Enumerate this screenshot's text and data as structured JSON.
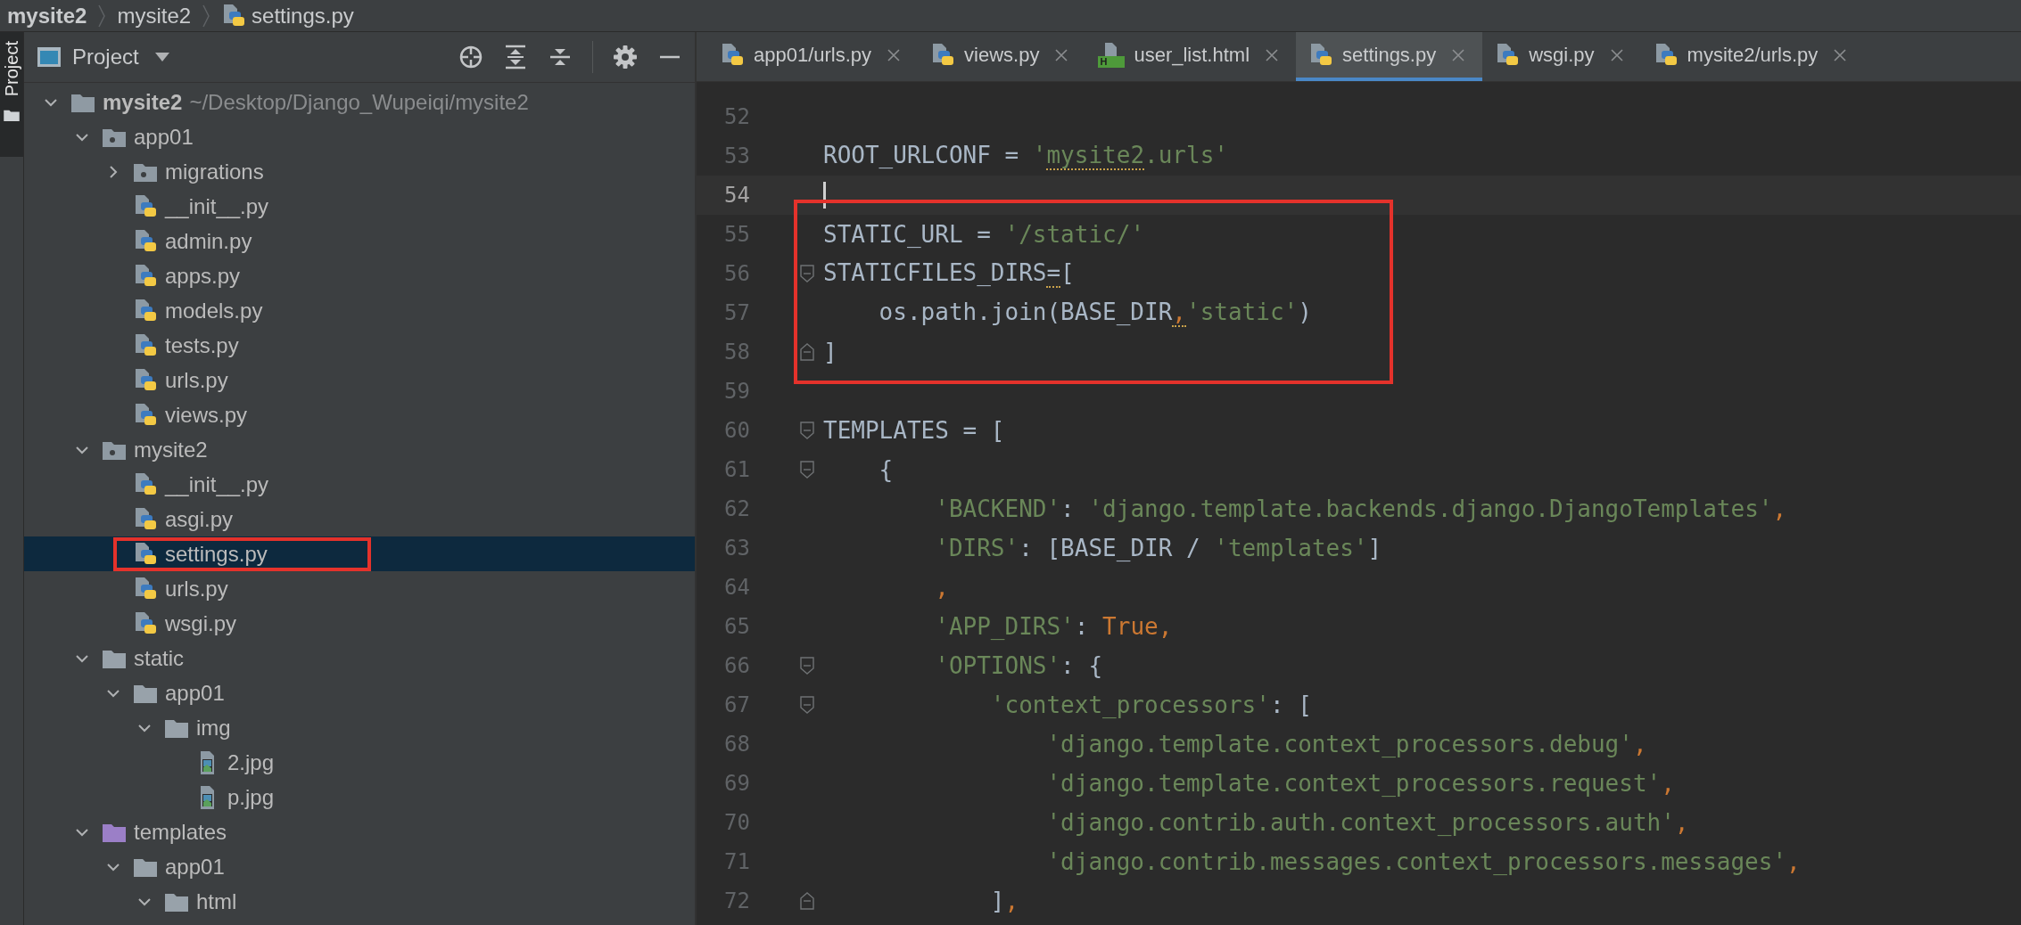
{
  "breadcrumb": [
    {
      "label": "mysite2",
      "kind": "project"
    },
    {
      "label": "mysite2",
      "kind": "folder"
    },
    {
      "label": "settings.py",
      "kind": "python"
    }
  ],
  "side_strip": {
    "label": "Project",
    "selected": true
  },
  "project_panel": {
    "title": "Project",
    "tree": [
      {
        "name": "mysite2",
        "path": "~/Desktop/Django_Wupeiqi/mysite2",
        "kind": "root",
        "expanded": true,
        "selected": false,
        "annotated": false,
        "children": [
          {
            "name": "app01",
            "kind": "package",
            "expanded": true,
            "selected": false,
            "annotated": false,
            "children": [
              {
                "name": "migrations",
                "kind": "package",
                "expanded": false,
                "selected": false,
                "annotated": false
              },
              {
                "name": "__init__.py",
                "kind": "python",
                "selected": false,
                "annotated": false
              },
              {
                "name": "admin.py",
                "kind": "python",
                "selected": false,
                "annotated": false
              },
              {
                "name": "apps.py",
                "kind": "python",
                "selected": false,
                "annotated": false
              },
              {
                "name": "models.py",
                "kind": "python",
                "selected": false,
                "annotated": false
              },
              {
                "name": "tests.py",
                "kind": "python",
                "selected": false,
                "annotated": false
              },
              {
                "name": "urls.py",
                "kind": "python",
                "selected": false,
                "annotated": false
              },
              {
                "name": "views.py",
                "kind": "python",
                "selected": false,
                "annotated": false
              }
            ]
          },
          {
            "name": "mysite2",
            "kind": "package",
            "expanded": true,
            "selected": false,
            "annotated": false,
            "children": [
              {
                "name": "__init__.py",
                "kind": "python",
                "selected": false,
                "annotated": false
              },
              {
                "name": "asgi.py",
                "kind": "python",
                "selected": false,
                "annotated": false
              },
              {
                "name": "settings.py",
                "kind": "python",
                "selected": true,
                "annotated": true
              },
              {
                "name": "urls.py",
                "kind": "python",
                "selected": false,
                "annotated": false
              },
              {
                "name": "wsgi.py",
                "kind": "python",
                "selected": false,
                "annotated": false
              }
            ]
          },
          {
            "name": "static",
            "kind": "folder",
            "expanded": true,
            "selected": false,
            "annotated": false,
            "children": [
              {
                "name": "app01",
                "kind": "folder",
                "expanded": true,
                "selected": false,
                "annotated": false,
                "children": [
                  {
                    "name": "img",
                    "kind": "folder",
                    "expanded": true,
                    "selected": false,
                    "annotated": false,
                    "children": [
                      {
                        "name": "2.jpg",
                        "kind": "image",
                        "selected": false,
                        "annotated": false
                      },
                      {
                        "name": "p.jpg",
                        "kind": "image",
                        "selected": false,
                        "annotated": false
                      }
                    ]
                  }
                ]
              }
            ]
          },
          {
            "name": "templates",
            "kind": "templates",
            "expanded": true,
            "selected": false,
            "annotated": false,
            "children": [
              {
                "name": "app01",
                "kind": "folder",
                "expanded": true,
                "selected": false,
                "annotated": false,
                "children": [
                  {
                    "name": "html",
                    "kind": "folder",
                    "expanded": true,
                    "selected": false,
                    "annotated": false
                  }
                ]
              }
            ]
          }
        ]
      }
    ]
  },
  "tabs": [
    {
      "label": "app01/urls.py",
      "kind": "python",
      "selected": false
    },
    {
      "label": "views.py",
      "kind": "python",
      "selected": false
    },
    {
      "label": "user_list.html",
      "kind": "html",
      "badge": "H",
      "selected": false
    },
    {
      "label": "settings.py",
      "kind": "python",
      "selected": true
    },
    {
      "label": "wsgi.py",
      "kind": "python",
      "selected": false
    },
    {
      "label": "mysite2/urls.py",
      "kind": "python",
      "selected": false
    }
  ],
  "code": [
    {
      "number": "52",
      "kind": "plain",
      "current": false,
      "boxed": false
    },
    {
      "number": "53",
      "kind": "plain",
      "current": false,
      "boxed": false,
      "segments": [
        {
          "text": "ROOT_URLCONF = ",
          "kind": "plain"
        },
        {
          "text": "'",
          "kind": "string"
        },
        {
          "text": "mysite2",
          "kind": "string",
          "warn": true
        },
        {
          "text": ".urls'",
          "kind": "string"
        }
      ]
    },
    {
      "number": "54",
      "kind": "plain",
      "current": true,
      "boxed": false
    },
    {
      "number": "55",
      "kind": "plain",
      "current": false,
      "boxed": true,
      "segments": [
        {
          "text": "STATIC_URL = ",
          "kind": "plain"
        },
        {
          "text": "'/static/'",
          "kind": "string"
        }
      ]
    },
    {
      "number": "56",
      "kind": "fold_start",
      "current": false,
      "boxed": true,
      "segments": [
        {
          "text": "STATICFILES_DIRS",
          "kind": "plain"
        },
        {
          "text": "=",
          "kind": "plain",
          "warn": true
        },
        {
          "text": "[",
          "kind": "plain"
        }
      ]
    },
    {
      "number": "57",
      "kind": "plain",
      "current": false,
      "boxed": true,
      "segments": [
        {
          "text": "    os.path.join(BASE_DIR",
          "kind": "plain"
        },
        {
          "text": ",",
          "kind": "keyword",
          "warn": true
        },
        {
          "text": "'static'",
          "kind": "string"
        },
        {
          "text": ")",
          "kind": "plain"
        }
      ]
    },
    {
      "number": "58",
      "kind": "fold_end",
      "current": false,
      "boxed": true,
      "segments": [
        {
          "text": "]",
          "kind": "plain"
        }
      ]
    },
    {
      "number": "59",
      "kind": "plain",
      "current": false,
      "boxed": false
    },
    {
      "number": "60",
      "kind": "fold_start",
      "current": false,
      "boxed": false,
      "segments": [
        {
          "text": "TEMPLATES = [",
          "kind": "plain"
        }
      ]
    },
    {
      "number": "61",
      "kind": "fold_start",
      "current": false,
      "boxed": false,
      "segments": [
        {
          "text": "    {",
          "kind": "plain"
        }
      ]
    },
    {
      "number": "62",
      "kind": "plain",
      "current": false,
      "boxed": false,
      "segments": [
        {
          "text": "        'BACKEND'",
          "kind": "string"
        },
        {
          "text": ": ",
          "kind": "plain"
        },
        {
          "text": "'django.template.backends.django.DjangoTemplates'",
          "kind": "string"
        },
        {
          "text": ",",
          "kind": "keyword"
        }
      ]
    },
    {
      "number": "63",
      "kind": "plain",
      "current": false,
      "boxed": false,
      "segments": [
        {
          "text": "        'DIRS'",
          "kind": "string"
        },
        {
          "text": ": [BASE_DIR / ",
          "kind": "plain"
        },
        {
          "text": "'templates'",
          "kind": "string"
        },
        {
          "text": "]",
          "kind": "plain"
        }
      ]
    },
    {
      "number": "64",
      "kind": "plain",
      "current": false,
      "boxed": false,
      "segments": [
        {
          "text": "        ,",
          "kind": "keyword"
        }
      ]
    },
    {
      "number": "65",
      "kind": "plain",
      "current": false,
      "boxed": false,
      "segments": [
        {
          "text": "        'APP_DIRS'",
          "kind": "string"
        },
        {
          "text": ": ",
          "kind": "plain"
        },
        {
          "text": "True,",
          "kind": "keyword"
        }
      ]
    },
    {
      "number": "66",
      "kind": "fold_start",
      "current": false,
      "boxed": false,
      "segments": [
        {
          "text": "        'OPTIONS'",
          "kind": "string"
        },
        {
          "text": ": {",
          "kind": "plain"
        }
      ]
    },
    {
      "number": "67",
      "kind": "fold_start",
      "current": false,
      "boxed": false,
      "segments": [
        {
          "text": "            'context_processors'",
          "kind": "string"
        },
        {
          "text": ": [",
          "kind": "plain"
        }
      ]
    },
    {
      "number": "68",
      "kind": "plain",
      "current": false,
      "boxed": false,
      "segments": [
        {
          "text": "                'django.template.context_processors.debug'",
          "kind": "string"
        },
        {
          "text": ",",
          "kind": "keyword"
        }
      ]
    },
    {
      "number": "69",
      "kind": "plain",
      "current": false,
      "boxed": false,
      "segments": [
        {
          "text": "                'django.template.context_processors.request'",
          "kind": "string"
        },
        {
          "text": ",",
          "kind": "keyword"
        }
      ]
    },
    {
      "number": "70",
      "kind": "plain",
      "current": false,
      "boxed": false,
      "segments": [
        {
          "text": "                'django.contrib.auth.context_processors.auth'",
          "kind": "string"
        },
        {
          "text": ",",
          "kind": "keyword"
        }
      ]
    },
    {
      "number": "71",
      "kind": "plain",
      "current": false,
      "boxed": false,
      "segments": [
        {
          "text": "                'django.contrib.messages.context_processors.messages'",
          "kind": "string"
        },
        {
          "text": ",",
          "kind": "keyword"
        }
      ]
    },
    {
      "number": "72",
      "kind": "fold_end",
      "current": false,
      "boxed": false,
      "segments": [
        {
          "text": "            ]",
          "kind": "plain"
        },
        {
          "text": ",",
          "kind": "keyword"
        }
      ]
    }
  ]
}
